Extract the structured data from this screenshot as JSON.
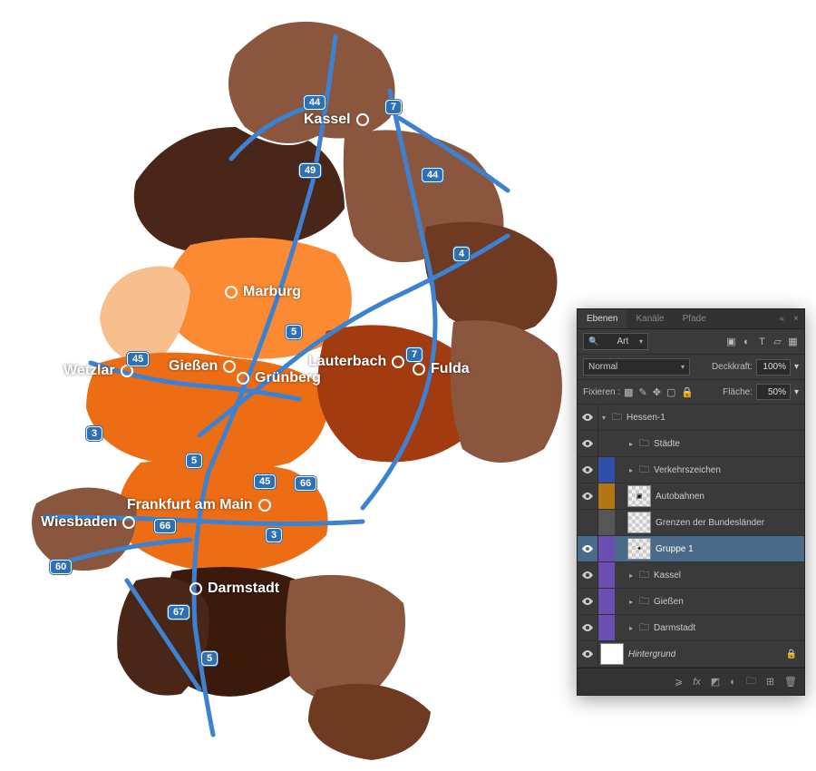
{
  "map": {
    "cities": {
      "kassel": "Kassel",
      "marburg": "Marburg",
      "giessen": "Gießen",
      "gruenberg": "Grünberg",
      "wetzlar": "Wetzlar",
      "lauterbach": "Lauterbach",
      "fulda": "Fulda",
      "frankfurt": "Frankfurt am Main",
      "wiesbaden": "Wiesbaden",
      "darmstadt": "Darmstadt"
    },
    "roads": {
      "a44_nw": "44",
      "a7_ne": "7",
      "a49": "49",
      "a44_e": "44",
      "a4": "4",
      "a5_mid": "5",
      "a45_w": "45",
      "a7_fulda": "7",
      "a3_w": "3",
      "a5_ffm": "5",
      "a45_ffm": "45",
      "a66_e": "66",
      "a66_w": "66",
      "a3_e": "3",
      "a60": "60",
      "a67": "67",
      "a5_s": "5"
    }
  },
  "panel": {
    "tabs": {
      "layers": "Ebenen",
      "channels": "Kanäle",
      "paths": "Pfade"
    },
    "filter_label": "Art",
    "blend_mode": "Normal",
    "opacity_label": "Deckkraft:",
    "opacity_value": "100%",
    "lock_label": "Fixieren :",
    "fill_label": "Fläche:",
    "fill_value": "50%",
    "layers": {
      "root": "Hessen-1",
      "staedte": "Städte",
      "verkehr": "Verkehrszeichen",
      "autobahnen": "Autobahnen",
      "grenzen": "Grenzen der Bundesländer",
      "gruppe1": "Gruppe 1",
      "kassel": "Kassel",
      "giessen": "Gießen",
      "darmstadt": "Darmstadt",
      "hintergrund": "Hintergrund"
    },
    "swatches": {
      "staedte": "#3a3a3a",
      "verkehr": "#2f4fa9",
      "autobahnen": "#b37614",
      "grenzen": "#565656",
      "gruppe1": "#6b4fb0",
      "kassel": "#6b4fb0",
      "giessen": "#6b4fb0",
      "darmstadt": "#6b4fb0"
    }
  }
}
